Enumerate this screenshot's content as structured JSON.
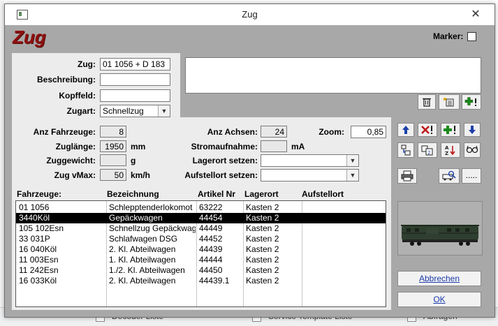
{
  "background": {
    "bottom_items": [
      "Decoder Liste",
      "Service Template Liste",
      "Abfragen"
    ]
  },
  "window": {
    "title": "Zug",
    "brand": "Zug",
    "marker_label": "Marker:"
  },
  "form": {
    "zug_label": "Zug:",
    "zug_value": "01 1056 + D 183",
    "beschreibung_label": "Beschreibung:",
    "beschreibung_value": "",
    "kopffeld_label": "Kopffeld:",
    "kopffeld_value": "",
    "zugart_label": "Zugart:",
    "zugart_value": "Schnellzug"
  },
  "stats": {
    "anz_fahrzeuge_label": "Anz Fahrzeuge:",
    "anz_fahrzeuge_value": "8",
    "zuglaenge_label": "Zuglänge:",
    "zuglaenge_value": "1950",
    "zuglaenge_unit": "mm",
    "zuggewicht_label": "Zuggewicht:",
    "zuggewicht_value": "",
    "zuggewicht_unit": "g",
    "zug_vmax_label": "Zug vMax:",
    "zug_vmax_value": "50",
    "zug_vmax_unit": "km/h",
    "anz_achsen_label": "Anz Achsen:",
    "anz_achsen_value": "24",
    "stromaufnahme_label": "Stromaufnahme:",
    "stromaufnahme_value": "",
    "stromaufnahme_unit": "mA",
    "lagerort_setzen_label": "Lagerort setzen:",
    "lagerort_setzen_value": "",
    "aufstellort_setzen_label": "Aufstellort setzen:",
    "aufstellort_setzen_value": "",
    "zoom_label": "Zoom:",
    "zoom_value": "0,85"
  },
  "table": {
    "headers": [
      "Fahrzeuge:",
      "Bezeichnung",
      "Artikel Nr",
      "Lagerort",
      "Aufstellort"
    ],
    "rows": [
      [
        "01 1056",
        "Schlepptenderlokomot",
        "63222",
        "Kasten 2",
        ""
      ],
      [
        "3440Köl",
        "Gepäckwagen",
        "44454",
        "Kasten 2",
        ""
      ],
      [
        "105 102Esn",
        "Schnellzug Gepäckwag",
        "44449",
        "Kasten 2",
        ""
      ],
      [
        "33 031P",
        "Schlafwagen DSG",
        "44452",
        "Kasten 2",
        ""
      ],
      [
        "16 040Köl",
        "2. Kl. Abteilwagen",
        "44439",
        "Kasten 2",
        ""
      ],
      [
        "11 003Esn",
        "1. Kl. Abteilwagen",
        "44444",
        "Kasten 2",
        ""
      ],
      [
        "11 242Esn",
        "1./2. Kl. Abteilwagen",
        "44450",
        "Kasten 2",
        ""
      ],
      [
        "16 033Köl",
        "2. Kl. Abteilwagen",
        "44439.1",
        "Kasten 2",
        ""
      ]
    ],
    "selected_row": 1
  },
  "buttons": {
    "abbrechen": "Abbrechen",
    "ok": "OK",
    "more": "....."
  },
  "colors": {
    "brand": "#8e1010",
    "dialog_gray": "#a8a8a8",
    "arrow_blue": "#1c3fa8",
    "delete_red": "#c01818",
    "add_green": "#1a8a1a"
  }
}
